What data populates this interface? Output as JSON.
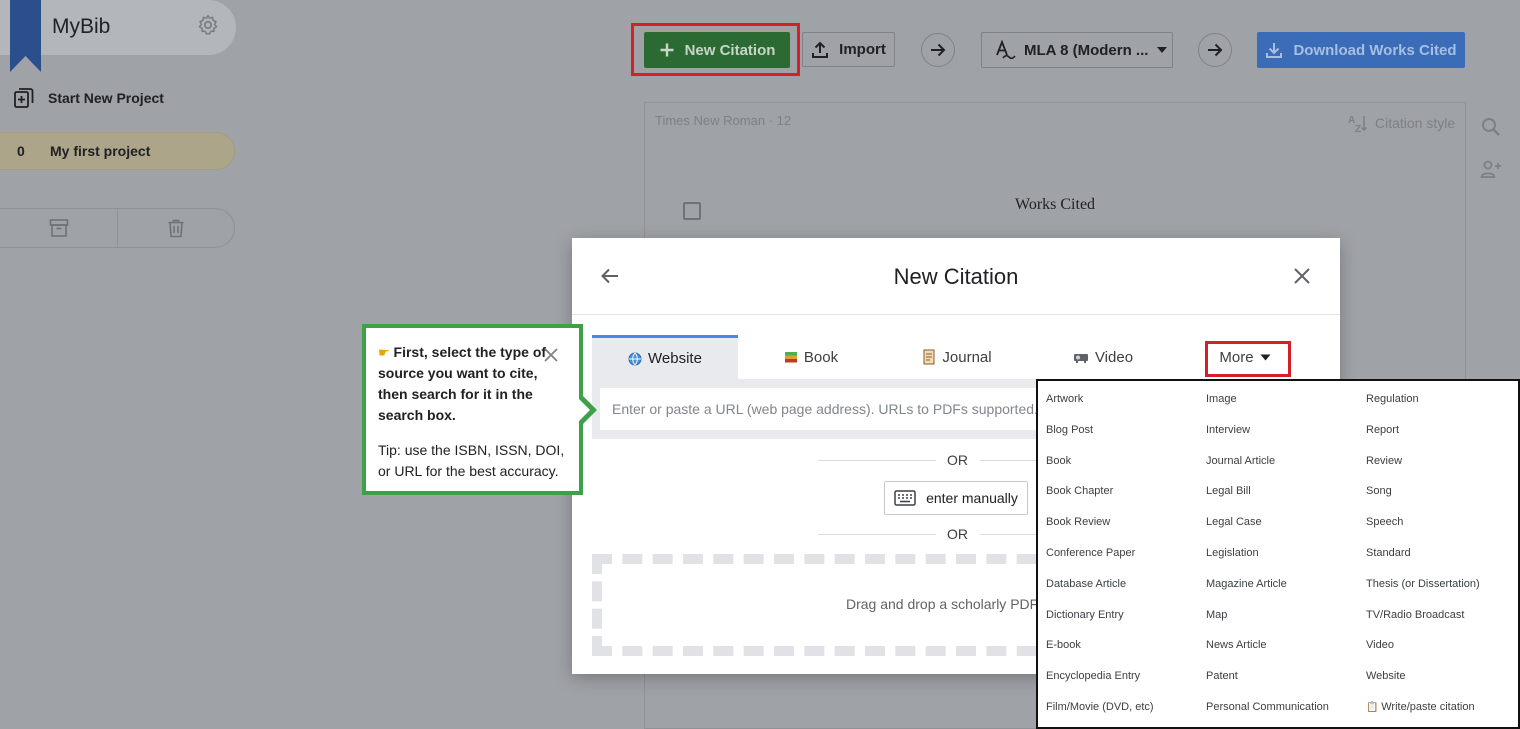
{
  "sidebar": {
    "app_name": "MyBib",
    "start_new_project": "Start New Project",
    "project": {
      "count": "0",
      "name": "My first project"
    }
  },
  "toolbar": {
    "new_citation": "New Citation",
    "import": "Import",
    "citation_style": "MLA 8 (Modern ...",
    "download": "Download Works Cited"
  },
  "document": {
    "font_info": "Times New Roman · 12",
    "citation_style_label": "Citation style",
    "heading": "Works Cited"
  },
  "modal": {
    "title": "New Citation",
    "tabs": [
      {
        "label": "Website",
        "icon": "globe-icon",
        "active": true
      },
      {
        "label": "Book",
        "icon": "book-icon",
        "active": false
      },
      {
        "label": "Journal",
        "icon": "scroll-icon",
        "active": false
      },
      {
        "label": "Video",
        "icon": "projector-icon",
        "active": false
      },
      {
        "label": "More",
        "icon": "caret-down-icon",
        "active": false
      }
    ],
    "url_placeholder": "Enter or paste a URL (web page address). URLs to PDFs supported.",
    "or_text": "OR",
    "enter_manually": "enter manually",
    "drop_text": "Drag and drop a scholarly PDF"
  },
  "tooltip": {
    "title": "First, select the type of source you want to cite, then search for it in the search box.",
    "body": "Tip: use the ISBN, ISSN, DOI, or URL for the best accuracy."
  },
  "more_menu": {
    "columns": [
      [
        "Artwork",
        "Blog Post",
        "Book",
        "Book Chapter",
        "Book Review",
        "Conference Paper",
        "Database Article",
        "Dictionary Entry",
        "E-book",
        "Encyclopedia Entry",
        "Film/Movie (DVD, etc)"
      ],
      [
        "Image",
        "Interview",
        "Journal Article",
        "Legal Bill",
        "Legal Case",
        "Legislation",
        "Magazine Article",
        "Map",
        "News Article",
        "Patent",
        "Personal Communication"
      ],
      [
        "Regulation",
        "Report",
        "Review",
        "Song",
        "Speech",
        "Standard",
        "Thesis (or Dissertation)",
        "TV/Radio Broadcast",
        "Video",
        "Website",
        "Write/paste citation"
      ]
    ]
  },
  "colors": {
    "overlay_bg": "#9fa2a7",
    "highlight_red": "#d62028",
    "tooltip_green": "#3ea14a",
    "active_tab_accent": "#4a86e8"
  }
}
